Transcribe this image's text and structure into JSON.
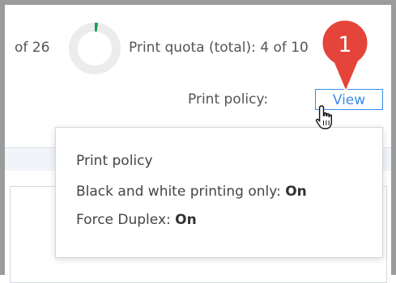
{
  "header": {
    "of_text": "of 26",
    "quota_label": "Print quota (total): 4 of 10"
  },
  "policy_row": {
    "label": "Print policy:",
    "button_label": "View"
  },
  "tooltip": {
    "title": "Print policy",
    "items": [
      {
        "label": "Black and white printing only:",
        "value": "On"
      },
      {
        "label": "Force Duplex:",
        "value": "On"
      }
    ]
  },
  "quota_ring": {
    "fraction": 0.04,
    "color": "#1a9e55",
    "track_color": "#ececec"
  },
  "annotation": {
    "number": "1",
    "color": "#e5443a"
  },
  "colors": {
    "accent": "#3a8be8"
  }
}
